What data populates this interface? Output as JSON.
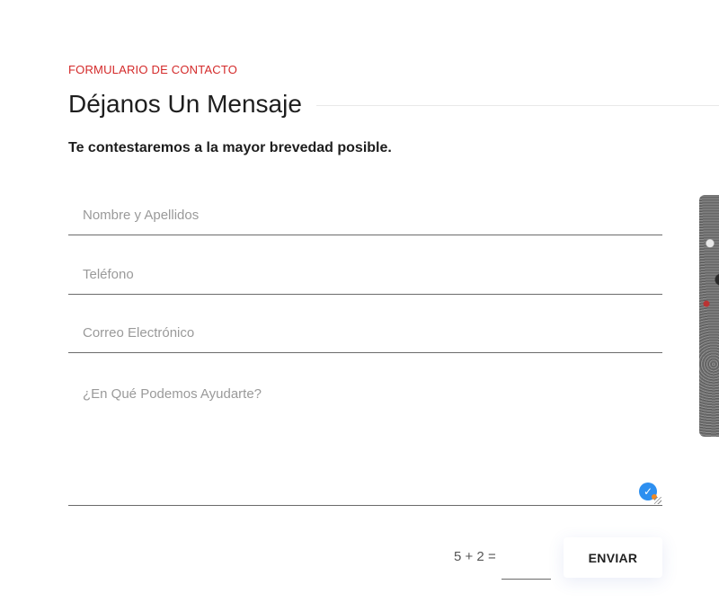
{
  "header": {
    "eyebrow": "FORMULARIO DE CONTACTO",
    "title": "Déjanos Un Mensaje",
    "subtitle": "Te contestaremos a la mayor brevedad posible."
  },
  "form": {
    "name_placeholder": "Nombre y Apellidos",
    "phone_placeholder": "Teléfono",
    "email_placeholder": "Correo Electrónico",
    "message_placeholder": "¿En Qué Podemos Ayudarte?",
    "captcha_question": "5 + 2 =",
    "captcha_value": "",
    "submit_label": "ENVIAR"
  },
  "icons": {
    "validation": "check-badge-icon",
    "resize": "resize-grip-icon"
  },
  "colors": {
    "accent": "#d42a2a",
    "check_badge": "#2d8ff0",
    "check_dot": "#f08a24"
  }
}
